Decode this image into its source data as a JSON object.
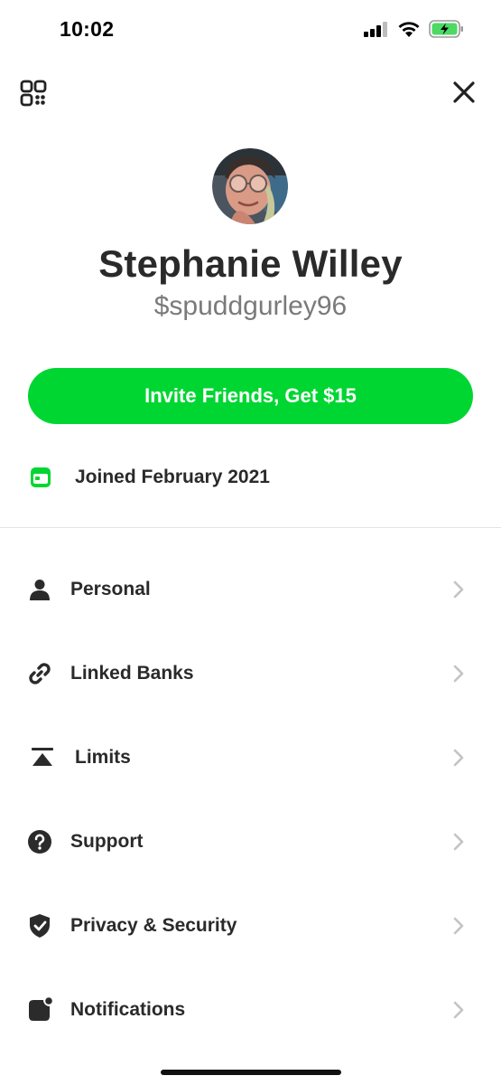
{
  "status_bar": {
    "time": "10:02",
    "icons": [
      "cellular-signal-icon",
      "wifi-icon",
      "battery-charging-icon"
    ],
    "battery_color": "#4cd964"
  },
  "top_bar": {
    "left_icon": "qr-code-icon",
    "right_icon": "close-icon"
  },
  "profile": {
    "name": "Stephanie Willey",
    "cashtag": "$spuddgurley96",
    "avatar_icon": "profile-photo"
  },
  "invite_button": {
    "label": "Invite Friends, Get $15",
    "color": "#00d632"
  },
  "joined": {
    "icon": "calendar-card-icon",
    "text": "Joined February 2021",
    "icon_color": "#00d632"
  },
  "menu": {
    "items": [
      {
        "label": "Personal",
        "icon": "person-icon"
      },
      {
        "label": "Linked Banks",
        "icon": "link-icon"
      },
      {
        "label": "Limits",
        "icon": "limits-icon"
      },
      {
        "label": "Support",
        "icon": "question-circle-icon"
      },
      {
        "label": "Privacy & Security",
        "icon": "shield-check-icon"
      },
      {
        "label": "Notifications",
        "icon": "notification-badge-icon"
      }
    ],
    "chevron_icon": "chevron-right-icon"
  }
}
